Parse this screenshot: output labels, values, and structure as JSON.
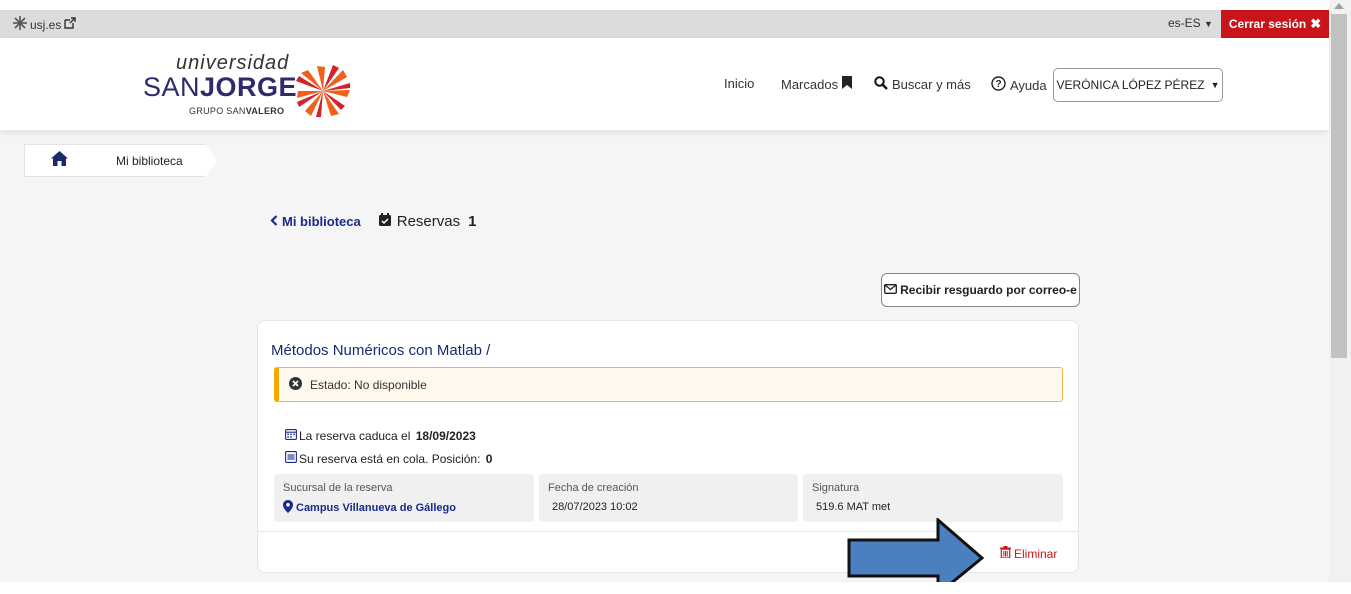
{
  "topbar": {
    "site_link": "usj.es",
    "language": "es-ES",
    "logout_label": "Cerrar sesión"
  },
  "logo": {
    "line1": "universidad",
    "line2a": "SAN",
    "line2b": "JORGE",
    "line3a": "GRUPO SAN",
    "line3b": "VALERO"
  },
  "nav": {
    "home": "Inicio",
    "bookmarks": "Marcados",
    "search": "Buscar y más",
    "help": "Ayuda",
    "user": "VERÓNICA LÓPEZ PÉREZ"
  },
  "breadcrumb": {
    "current": "Mi biblioteca"
  },
  "section": {
    "back_label": "Mi biblioteca",
    "title": "Reservas",
    "count": "1"
  },
  "mail_button": "Recibir resguardo por correo-e",
  "reservation": {
    "title": "Métodos Numéricos con Matlab /",
    "status": "Estado: No disponible",
    "expires_prefix": "La reserva caduca el ",
    "expires_date": "18/09/2023",
    "queue_prefix": "Su reserva está en cola. Posición: ",
    "queue_position": "0",
    "branch_label": "Sucursal de la reserva",
    "branch_value": "Campus Villanueva de Gállego",
    "created_label": "Fecha de creación",
    "created_value": "28/07/2023 10:02",
    "callnumber_label": "Signatura",
    "callnumber_value": "519.6 MAT met",
    "delete_label": "Eliminar"
  },
  "colors": {
    "accent": "#c8151b",
    "link": "#1a2a8c",
    "warning": "#f4a800",
    "arrow": "#4a7fc0"
  }
}
